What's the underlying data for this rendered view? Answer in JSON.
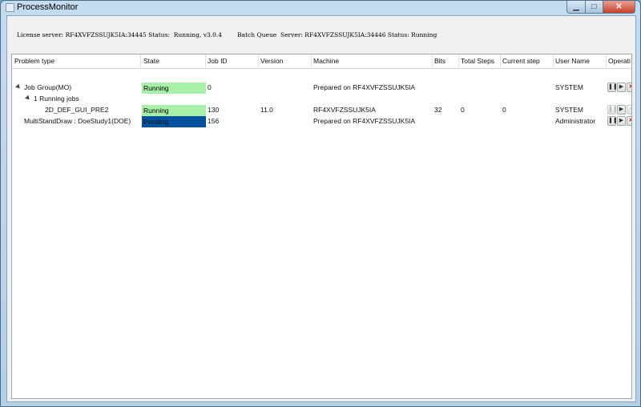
{
  "window": {
    "title": "ProcessMonitor",
    "min": "▁",
    "max": "□",
    "close": "✕"
  },
  "status": {
    "license": "License server: RF4XVFZSSUJK5IA:34445 Status:  Running, v3.0.4",
    "batch": "Batch Queue  Server: RF4XVFZSSUJK5IA:34446 Status: Running"
  },
  "columns": [
    "Problem type",
    "State",
    "Job ID",
    "Version",
    "Machine",
    "Bits",
    "Total Steps",
    "Current step",
    "User Name",
    "Operati"
  ],
  "rows": [
    {
      "problem": "Job Group(MO)",
      "state": "Running",
      "job_id": "0",
      "version": "",
      "machine": "Prepared on RF4XVFZSSUJK5IA",
      "bits": "",
      "total_steps": "",
      "current_step": "",
      "user": "SYSTEM"
    },
    {
      "problem": "1 Running jobs",
      "state": "",
      "job_id": "",
      "version": "",
      "machine": "",
      "bits": "",
      "total_steps": "",
      "current_step": "",
      "user": ""
    },
    {
      "problem": "2D_DEF_GUI_PRE2",
      "state": "Running",
      "job_id": "130",
      "version": "11.0",
      "machine": "RF4XVFZSSUJK5IA",
      "bits": "32",
      "total_steps": "0",
      "current_step": "0",
      "user": "SYSTEM"
    },
    {
      "problem": "MultiStandDraw : DoeStudy1(DOE)",
      "state": "Pending",
      "job_id": "156",
      "version": "",
      "machine": "Prepared on RF4XVFZSSUJK5IA",
      "bits": "",
      "total_steps": "",
      "current_step": "",
      "user": "Administrator"
    }
  ],
  "colors": {
    "running": "#a8f0a8",
    "pending": "#0050a0"
  },
  "icons": {
    "pause": "❚❚",
    "play": "▶",
    "stop": "✕"
  },
  "scroll": {
    "left": "◀",
    "right": "▶",
    "grip": "|||"
  }
}
